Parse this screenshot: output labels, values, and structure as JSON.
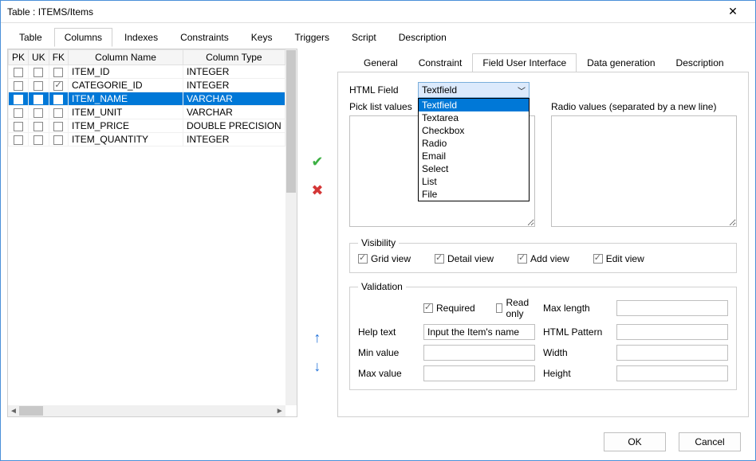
{
  "window": {
    "title": "Table : ITEMS/Items"
  },
  "mainTabs": [
    "Table",
    "Columns",
    "Indexes",
    "Constraints",
    "Keys",
    "Triggers",
    "Script",
    "Description"
  ],
  "mainTabActive": 1,
  "gridHeaders": {
    "pk": "PK",
    "uk": "UK",
    "fk": "FK",
    "name": "Column Name",
    "type": "Column Type"
  },
  "rows": [
    {
      "pk": false,
      "uk": false,
      "fk": false,
      "name": "ITEM_ID",
      "type": "INTEGER",
      "sel": false
    },
    {
      "pk": false,
      "uk": false,
      "fk": true,
      "name": "CATEGORIE_ID",
      "type": "INTEGER",
      "sel": false
    },
    {
      "pk": false,
      "uk": false,
      "fk": false,
      "name": "ITEM_NAME",
      "type": "VARCHAR",
      "sel": true
    },
    {
      "pk": false,
      "uk": false,
      "fk": false,
      "name": "ITEM_UNIT",
      "type": "VARCHAR",
      "sel": false
    },
    {
      "pk": false,
      "uk": false,
      "fk": false,
      "name": "ITEM_PRICE",
      "type": "DOUBLE PRECISION",
      "sel": false
    },
    {
      "pk": false,
      "uk": false,
      "fk": false,
      "name": "ITEM_QUANTITY",
      "type": "INTEGER",
      "sel": false
    }
  ],
  "subTabs": [
    "General",
    "Constraint",
    "Field User Interface",
    "Data generation",
    "Description"
  ],
  "subTabActive": 2,
  "field": {
    "htmlFieldLabel": "HTML Field",
    "htmlFieldValue": "Textfield",
    "htmlFieldOptions": [
      "Textfield",
      "Textarea",
      "Checkbox",
      "Radio",
      "Email",
      "Select",
      "List",
      "File"
    ],
    "pickListLabel": "Pick list values",
    "radioListLabel": "Radio values  (separated by a new line)"
  },
  "visibility": {
    "legend": "Visibility",
    "grid": {
      "label": "Grid view",
      "checked": true
    },
    "detail": {
      "label": "Detail view",
      "checked": true
    },
    "add": {
      "label": "Add view",
      "checked": true
    },
    "edit": {
      "label": "Edit view",
      "checked": true
    }
  },
  "validation": {
    "legend": "Validation",
    "required": {
      "label": "Required",
      "checked": true
    },
    "readonly": {
      "label": "Read only",
      "checked": false
    },
    "maxlength": {
      "label": "Max length",
      "value": ""
    },
    "helptext": {
      "label": "Help text",
      "value": "Input the Item's name"
    },
    "htmlpattern": {
      "label": "HTML Pattern",
      "value": ""
    },
    "minvalue": {
      "label": "Min value",
      "value": ""
    },
    "width": {
      "label": "Width",
      "value": ""
    },
    "maxvalue": {
      "label": "Max value",
      "value": ""
    },
    "height": {
      "label": "Height",
      "value": ""
    }
  },
  "footer": {
    "ok": "OK",
    "cancel": "Cancel"
  }
}
